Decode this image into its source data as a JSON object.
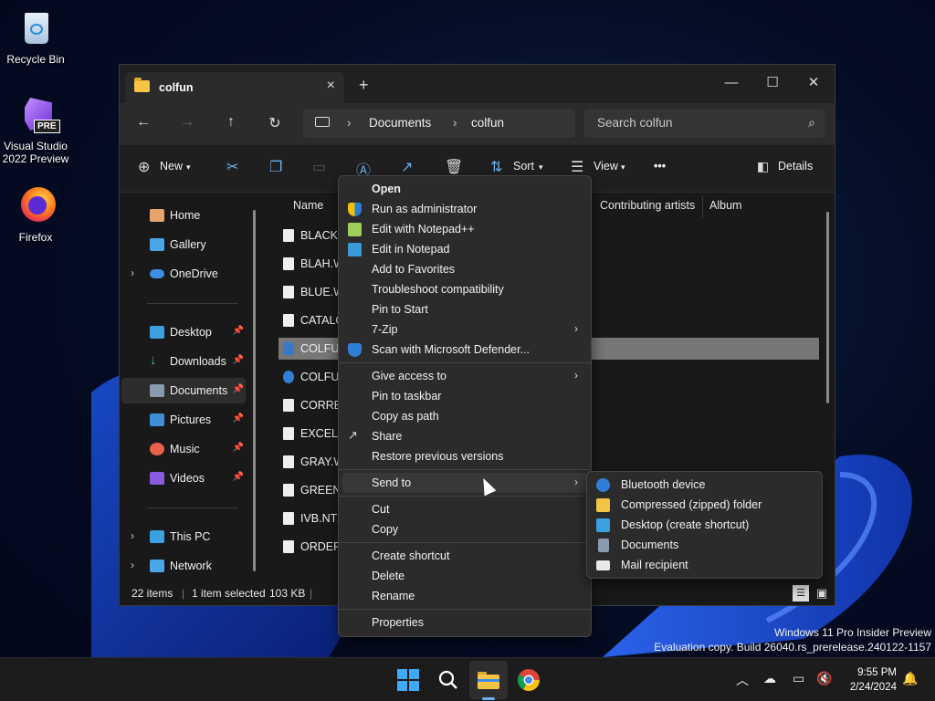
{
  "desktop": {
    "icons": [
      {
        "label": "Recycle Bin",
        "icon": "recycle-bin-icon"
      },
      {
        "label": "Visual Studio 2022 Preview",
        "badge": "PRE",
        "icon": "visual-studio-icon"
      },
      {
        "label": "Firefox",
        "icon": "firefox-icon"
      }
    ]
  },
  "window": {
    "tab_title": "colfun",
    "new_tab": "+",
    "controls": {
      "minimize": "—",
      "maximize": "☐",
      "close": "✕"
    },
    "address": {
      "crumb1": "Documents",
      "crumb2": "colfun"
    },
    "search_placeholder": "Search colfun",
    "commands": {
      "new": "New",
      "sort": "Sort",
      "view": "View",
      "more": "•••",
      "details": "Details"
    },
    "sidebar": [
      {
        "label": "Home",
        "pinned": false,
        "expander": false,
        "icon": "home-icon"
      },
      {
        "label": "Gallery",
        "pinned": false,
        "expander": false,
        "icon": "gallery-icon"
      },
      {
        "label": "OneDrive",
        "pinned": false,
        "expander": true,
        "icon": "onedrive-icon"
      },
      {
        "label": "Desktop",
        "pinned": true,
        "expander": false,
        "icon": "desktop-icon"
      },
      {
        "label": "Downloads",
        "pinned": true,
        "expander": false,
        "icon": "downloads-icon"
      },
      {
        "label": "Documents",
        "pinned": true,
        "expander": false,
        "icon": "documents-icon",
        "selected": true
      },
      {
        "label": "Pictures",
        "pinned": true,
        "expander": false,
        "icon": "pictures-icon"
      },
      {
        "label": "Music",
        "pinned": true,
        "expander": false,
        "icon": "music-icon"
      },
      {
        "label": "Videos",
        "pinned": true,
        "expander": false,
        "icon": "videos-icon"
      },
      {
        "label": "This PC",
        "pinned": false,
        "expander": true,
        "icon": "this-pc-icon"
      },
      {
        "label": "Network",
        "pinned": false,
        "expander": true,
        "icon": "network-icon"
      }
    ],
    "columns": {
      "name": "Name",
      "artists": "Contributing artists",
      "album": "Album"
    },
    "files": [
      "BLACK.W",
      "BLAH.W",
      "BLUE.W",
      "CATALO",
      "COLFUN",
      "COLFUN",
      "CORREC",
      "EXCEL.W",
      "GRAY.W",
      "GREEN.W",
      "IVB.NTZ",
      "ORDER.I"
    ],
    "status": {
      "count": "22 items",
      "selected": "1 item selected",
      "size": "103 KB"
    }
  },
  "context_menu": [
    {
      "label": "Open",
      "bold": true
    },
    {
      "label": "Run as administrator",
      "icon": "shield-icon"
    },
    {
      "label": "Edit with Notepad++",
      "icon": "notepadpp-icon"
    },
    {
      "label": "Edit in Notepad",
      "icon": "notepad-icon"
    },
    {
      "label": "Add to Favorites"
    },
    {
      "label": "Troubleshoot compatibility"
    },
    {
      "label": "Pin to Start"
    },
    {
      "label": "7-Zip",
      "submenu": true
    },
    {
      "label": "Scan with Microsoft Defender...",
      "icon": "defender-icon"
    },
    {
      "label": "Give access to",
      "submenu": true
    },
    {
      "label": "Pin to taskbar"
    },
    {
      "label": "Copy as path"
    },
    {
      "label": "Share",
      "icon": "share-icon"
    },
    {
      "label": "Restore previous versions"
    },
    {
      "label": "Send to",
      "submenu": true,
      "hover": true
    },
    {
      "label": "Cut"
    },
    {
      "label": "Copy"
    },
    {
      "label": "Create shortcut"
    },
    {
      "label": "Delete"
    },
    {
      "label": "Rename"
    },
    {
      "label": "Properties"
    }
  ],
  "send_to_menu": [
    {
      "label": "Bluetooth device",
      "icon": "bluetooth-icon"
    },
    {
      "label": "Compressed (zipped) folder",
      "icon": "zip-folder-icon"
    },
    {
      "label": "Desktop (create shortcut)",
      "icon": "desktop-icon"
    },
    {
      "label": "Documents",
      "icon": "documents-icon"
    },
    {
      "label": "Mail recipient",
      "icon": "mail-icon"
    }
  ],
  "watermark": {
    "line1": "Windows 11 Pro Insider Preview",
    "line2": "Evaluation copy. Build 26040.rs_prerelease.240122-1157"
  },
  "taskbar": {
    "time": "9:55 PM",
    "date": "2/24/2024"
  }
}
